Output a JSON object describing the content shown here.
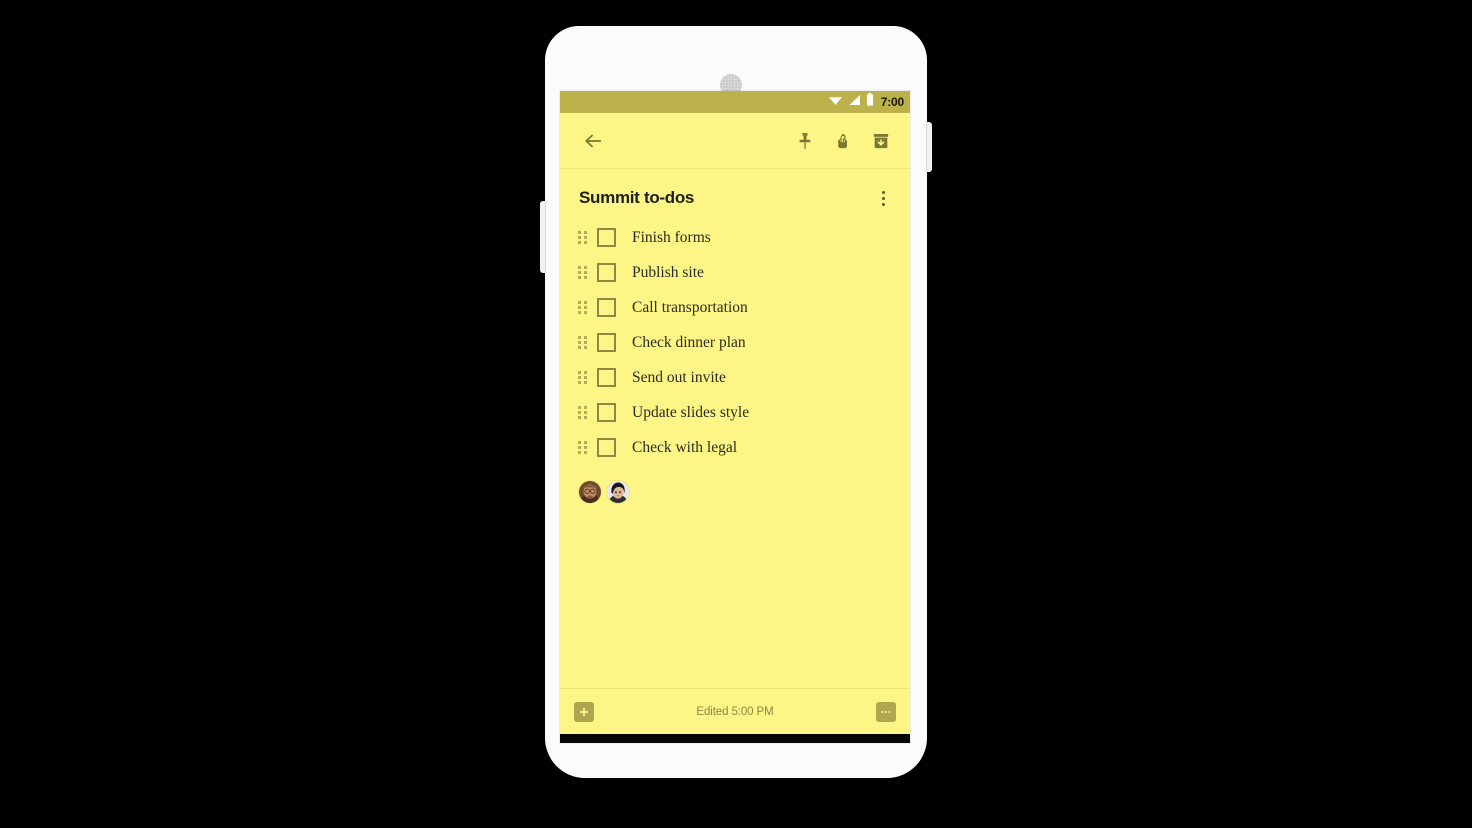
{
  "device": {
    "speaker_icon": "speaker-grille-icon",
    "volume_rocker": "volume-rocker",
    "power_button": "power-button"
  },
  "status_bar": {
    "time": "7:00",
    "background": "#bcb14a",
    "icons": [
      "wifi-icon",
      "cell-signal-icon",
      "battery-icon"
    ]
  },
  "app_toolbar": {
    "background": "#fdf585",
    "back_icon": "back-arrow-icon",
    "actions": [
      {
        "name": "pin-icon",
        "label": "Pin note"
      },
      {
        "name": "reminder-icon",
        "label": "Reminder"
      },
      {
        "name": "archive-icon",
        "label": "Archive"
      }
    ]
  },
  "note": {
    "title": "Summit to-dos",
    "background": "#fdf585",
    "overflow_icon": "more-vertical-icon",
    "items": [
      {
        "label": "Finish forms",
        "checked": false
      },
      {
        "label": "Publish site",
        "checked": false
      },
      {
        "label": "Call transportation",
        "checked": false
      },
      {
        "label": "Check dinner plan",
        "checked": false
      },
      {
        "label": "Send out invite",
        "checked": false
      },
      {
        "label": "Update slides style",
        "checked": false
      },
      {
        "label": "Check with legal",
        "checked": false
      }
    ],
    "collaborators": [
      {
        "name": "collaborator-avatar-1",
        "alt": "Collaborator 1"
      },
      {
        "name": "collaborator-avatar-2",
        "alt": "Collaborator 2"
      }
    ]
  },
  "note_bottom_bar": {
    "add_icon": "plus-icon",
    "edited_text": "Edited 5:00 PM",
    "more_icon": "more-horizontal-icon"
  },
  "nav_bar": {
    "background": "#060606",
    "back_icon": "nav-back-icon",
    "home_icon": "nav-home-icon",
    "recents_icon": "nav-recents-icon"
  },
  "colors": {
    "note_yellow": "#fdf585",
    "status_bar_olive": "#bcb14a",
    "icon_olive": "#7d7731",
    "text_dark": "#2b2b20"
  }
}
